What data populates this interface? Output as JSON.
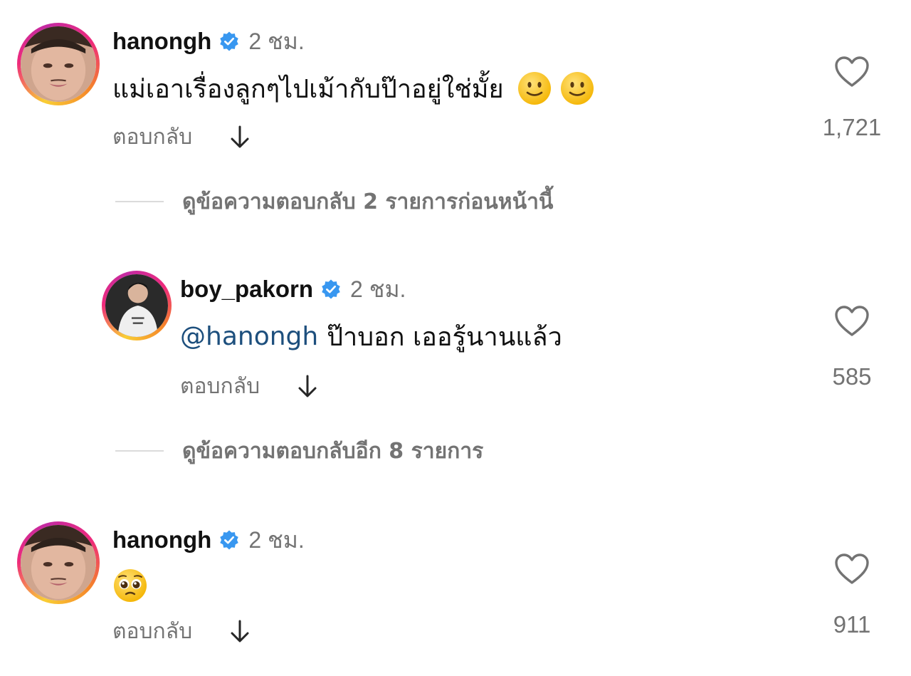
{
  "comments": [
    {
      "username": "hanongh",
      "time": "2 ชม.",
      "text": "แม่เอาเรื่องลูกๆไปเม้ากับป๊าอยู่ใช่มั้ย",
      "emoji": [
        "slightly-smiling-face",
        "slightly-smiling-face"
      ],
      "reply_label": "ตอบกลับ",
      "likes": "1,721"
    },
    {
      "username": "boy_pakorn",
      "time": "2 ชม.",
      "mention": "@hanongh",
      "text": "ป๊าบอก เออรู้นานแล้ว",
      "reply_label": "ตอบกลับ",
      "likes": "585"
    },
    {
      "username": "hanongh",
      "time": "2 ชม.",
      "emoji": [
        "pleading-face"
      ],
      "reply_label": "ตอบกลับ",
      "likes": "911"
    }
  ],
  "view_previous_replies": "ดูข้อความตอบกลับ 2 รายการก่อนหน้านี้",
  "view_more_replies": "ดูข้อความตอบกลับอีก 8 รายการ",
  "colors": {
    "verified": "#3897f0",
    "mention": "#1d4f7d",
    "secondary_text": "#737373"
  }
}
